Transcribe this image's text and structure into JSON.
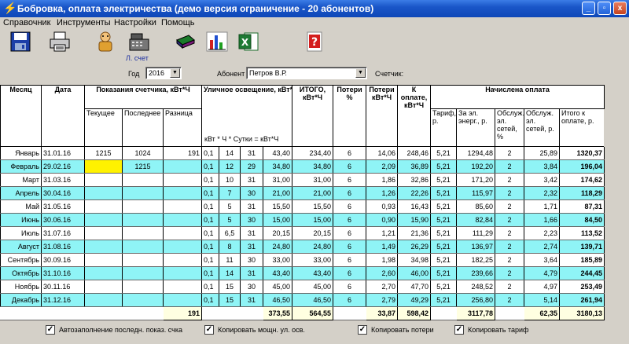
{
  "window": {
    "title": "Бобровка, оплата электричества (демо версия ограничение - 20 абонентов)",
    "buttons": [
      "_",
      "▫",
      "x"
    ]
  },
  "menu": [
    "Справочник",
    "Инструменты",
    "Настройки",
    "Помощь"
  ],
  "toolbar": {
    "buttons": [
      "save-icon",
      "print-icon",
      "users-icon",
      "cash-register-icon",
      "book-icon",
      "chart-icon",
      "excel-icon",
      "help-icon"
    ],
    "caption": "Л. счет"
  },
  "filters": {
    "year_label": "Год",
    "year_value": "2016",
    "subscriber_label": "Абонент",
    "subscriber_value": "Петров В.Р.",
    "meter_label": "Счетчик:"
  },
  "grid": {
    "headers": {
      "month": "Месяц",
      "date": "Дата",
      "meter": "Показания счетчика, кВт*Ч",
      "current": "Текущее",
      "last": "Последнее",
      "diff": "Разница",
      "street": "Уличное освещение, кВт*Ч",
      "street_sub": "кВт * Ч * Сутки = кВт*Ч",
      "total": "ИТОГО, кВт*Ч",
      "losses_pct": "Потери %",
      "losses_kwh": "Потери кВт*Ч",
      "to_pay": "К оплате, кВт*Ч",
      "charged": "Начислена оплата",
      "tariff": "Тариф, р.",
      "energy": "За эл. энерг., р.",
      "service_pct": "Обслуж. эл. сетей, %",
      "service_rub": "Обслуж. эл. сетей, р.",
      "total_rub": "Итого к оплате, р."
    },
    "rows": [
      [
        "Январь",
        "31.01.16",
        "1215",
        "1024",
        "191",
        "0,1",
        "14",
        "31",
        "43,40",
        "234,40",
        "6",
        "14,06",
        "248,46",
        "5,21",
        "1294,48",
        "2",
        "25,89",
        "1320,37"
      ],
      [
        "Февраль",
        "29.02.16",
        "",
        "1215",
        "",
        "0,1",
        "12",
        "29",
        "34,80",
        "34,80",
        "6",
        "2,09",
        "36,89",
        "5,21",
        "192,20",
        "2",
        "3,84",
        "196,04"
      ],
      [
        "Март",
        "31.03.16",
        "",
        "",
        "",
        "0,1",
        "10",
        "31",
        "31,00",
        "31,00",
        "6",
        "1,86",
        "32,86",
        "5,21",
        "171,20",
        "2",
        "3,42",
        "174,62"
      ],
      [
        "Апрель",
        "30.04.16",
        "",
        "",
        "",
        "0,1",
        "7",
        "30",
        "21,00",
        "21,00",
        "6",
        "1,26",
        "22,26",
        "5,21",
        "115,97",
        "2",
        "2,32",
        "118,29"
      ],
      [
        "Май",
        "31.05.16",
        "",
        "",
        "",
        "0,1",
        "5",
        "31",
        "15,50",
        "15,50",
        "6",
        "0,93",
        "16,43",
        "5,21",
        "85,60",
        "2",
        "1,71",
        "87,31"
      ],
      [
        "Июнь",
        "30.06.16",
        "",
        "",
        "",
        "0,1",
        "5",
        "30",
        "15,00",
        "15,00",
        "6",
        "0,90",
        "15,90",
        "5,21",
        "82,84",
        "2",
        "1,66",
        "84,50"
      ],
      [
        "Июль",
        "31.07.16",
        "",
        "",
        "",
        "0,1",
        "6,5",
        "31",
        "20,15",
        "20,15",
        "6",
        "1,21",
        "21,36",
        "5,21",
        "111,29",
        "2",
        "2,23",
        "113,52"
      ],
      [
        "Август",
        "31.08.16",
        "",
        "",
        "",
        "0,1",
        "8",
        "31",
        "24,80",
        "24,80",
        "6",
        "1,49",
        "26,29",
        "5,21",
        "136,97",
        "2",
        "2,74",
        "139,71"
      ],
      [
        "Сентябрь",
        "30.09.16",
        "",
        "",
        "",
        "0,1",
        "11",
        "30",
        "33,00",
        "33,00",
        "6",
        "1,98",
        "34,98",
        "5,21",
        "182,25",
        "2",
        "3,64",
        "185,89"
      ],
      [
        "Октябрь",
        "31.10.16",
        "",
        "",
        "",
        "0,1",
        "14",
        "31",
        "43,40",
        "43,40",
        "6",
        "2,60",
        "46,00",
        "5,21",
        "239,66",
        "2",
        "4,79",
        "244,45"
      ],
      [
        "Ноябрь",
        "30.11.16",
        "",
        "",
        "",
        "0,1",
        "15",
        "30",
        "45,00",
        "45,00",
        "6",
        "2,70",
        "47,70",
        "5,21",
        "248,52",
        "2",
        "4,97",
        "253,49"
      ],
      [
        "Декабрь",
        "31.12.16",
        "",
        "",
        "",
        "0,1",
        "15",
        "31",
        "46,50",
        "46,50",
        "6",
        "2,79",
        "49,29",
        "5,21",
        "256,80",
        "2",
        "5,14",
        "261,94"
      ]
    ],
    "totals": {
      "diff": "191",
      "street": "373,55",
      "total": "564,55",
      "losses_kwh": "33,87",
      "to_pay": "598,42",
      "energy": "3117,78",
      "service_rub": "62,35",
      "total_rub": "3180,13"
    }
  },
  "checkboxes": [
    {
      "label": "Автозаполнение последн. показ. счка",
      "checked": "✓"
    },
    {
      "label": "Копировать мощн. ул. осв.",
      "checked": "✓"
    },
    {
      "label": "Копировать потери",
      "checked": "✓"
    },
    {
      "label": "Копировать тариф",
      "checked": "✓"
    }
  ]
}
